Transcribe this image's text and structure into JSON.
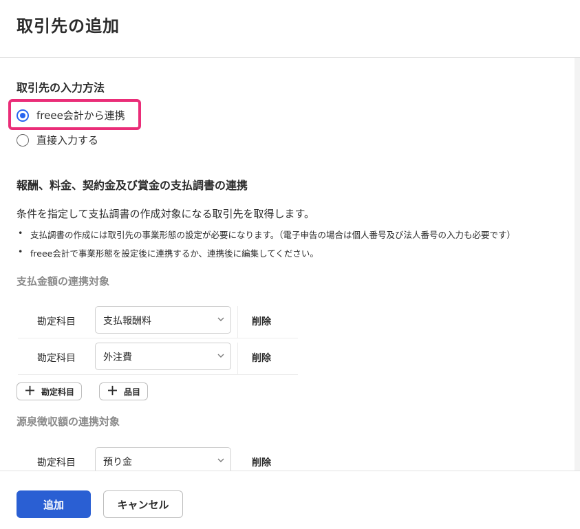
{
  "modal": {
    "title": "取引先の追加"
  },
  "input_method": {
    "title": "取引先の入力方法",
    "options": [
      {
        "label": "freee会計から連携",
        "checked": true
      },
      {
        "label": "直接入力する",
        "checked": false
      }
    ]
  },
  "integration": {
    "title": "報酬、料金、契約金及び賞金の支払調書の連携",
    "description": "条件を指定して支払調書の作成対象になる取引先を取得します。",
    "bullets": [
      "支払調書の作成には取引先の事業形態の設定が必要になります。（電子申告の場合は個人番号及び法人番号の入力も必要です）",
      "freee会計で事業形態を設定後に連携するか、連携後に編集してください。"
    ]
  },
  "payment_target": {
    "title": "支払金額の連携対象",
    "rows": [
      {
        "label": "勘定科目",
        "value": "支払報酬料",
        "delete_label": "削除"
      },
      {
        "label": "勘定科目",
        "value": "外注費",
        "delete_label": "削除"
      }
    ],
    "add_account_label": "勘定科目",
    "add_item_label": "品目"
  },
  "withholding_target": {
    "title": "源泉徴収額の連携対象",
    "rows": [
      {
        "label": "勘定科目",
        "value": "預り金",
        "delete_label": "削除"
      }
    ]
  },
  "footer": {
    "add_label": "追加",
    "cancel_label": "キャンセル"
  },
  "colors": {
    "primary": "#2a5fd3",
    "radio_accent": "#2864f0",
    "highlight": "#ea2d78"
  }
}
